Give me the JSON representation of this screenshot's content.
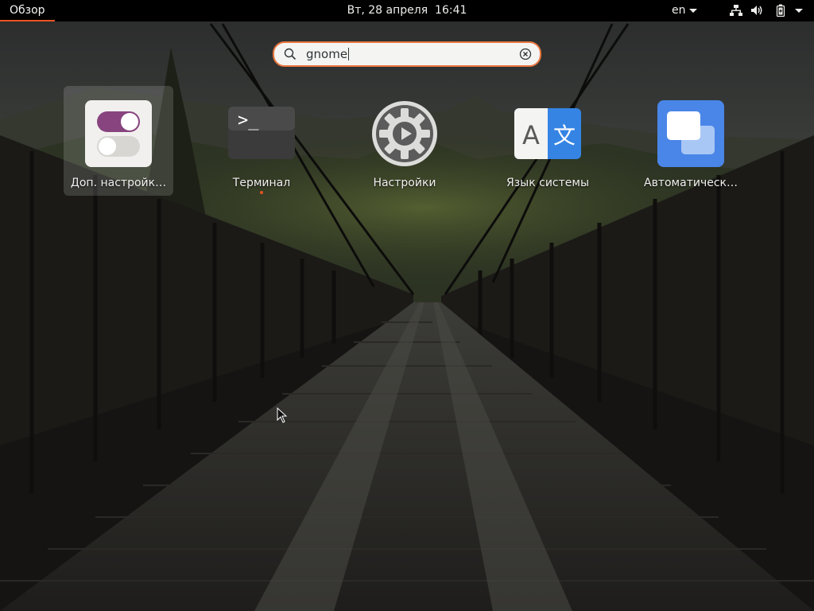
{
  "topbar": {
    "activities_label": "Обзор",
    "datetime": "Вт, 28 апреля  16:41",
    "keyboard_layout": "en",
    "indicators": [
      "network-icon",
      "volume-icon",
      "battery-icon"
    ]
  },
  "search": {
    "value": "gnome",
    "icon": "search-icon",
    "clear_icon": "clear-icon"
  },
  "apps": [
    {
      "label": "Доп. настройк…",
      "icon": "tweaks-icon",
      "selected": true,
      "running": false
    },
    {
      "label": "Терминал",
      "icon": "terminal-icon",
      "selected": false,
      "running": true
    },
    {
      "label": "Настройки",
      "icon": "settings-icon",
      "selected": false,
      "running": false
    },
    {
      "label": "Язык системы",
      "icon": "language-icon",
      "selected": false,
      "running": false
    },
    {
      "label": "Автоматическ…",
      "icon": "autostart-icon",
      "selected": false,
      "running": false
    }
  ],
  "colors": {
    "accent": "#e95420",
    "topbar_bg": "#000000",
    "search_border": "#e9773f"
  }
}
